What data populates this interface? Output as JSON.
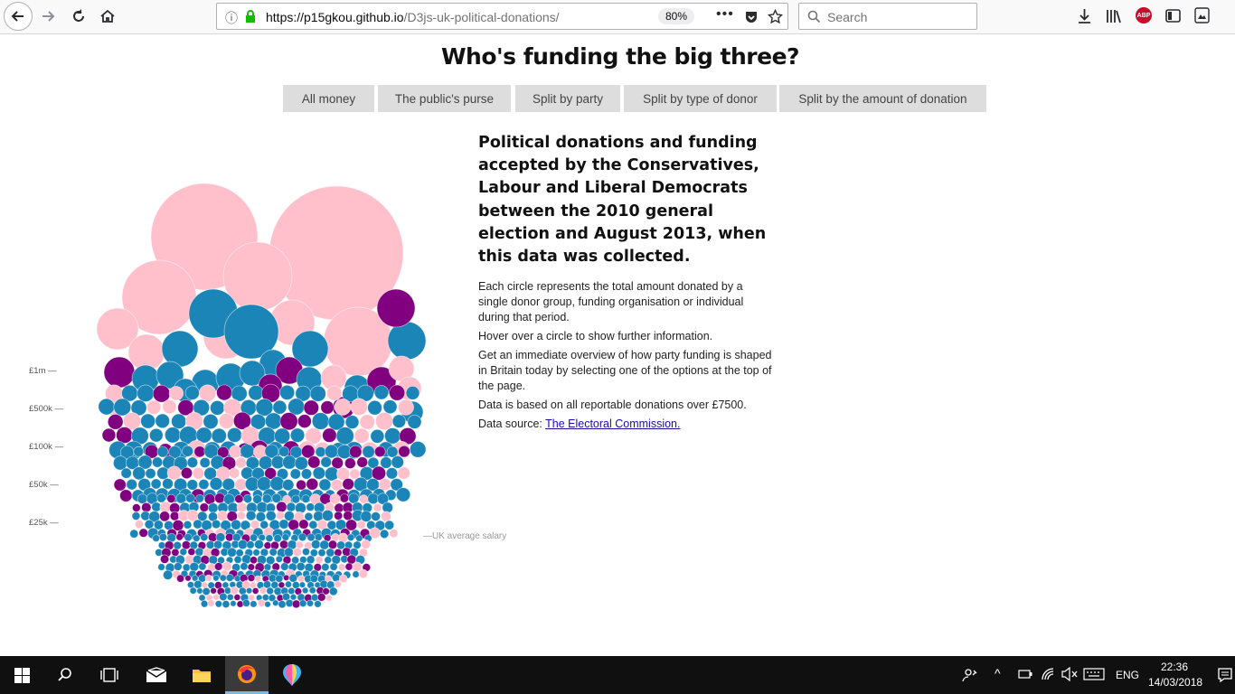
{
  "browser": {
    "url_host": "https://p15gkou.github.io",
    "url_path": "/D3js-uk-political-donations/",
    "zoom": "80%",
    "search_placeholder": "Search"
  },
  "page": {
    "title": "Who's funding the big three?",
    "nav": [
      {
        "label": "All money"
      },
      {
        "label": "The public's purse"
      },
      {
        "label": "Split by party"
      },
      {
        "label": "Split by type of donor"
      },
      {
        "label": "Split by the amount of donation"
      }
    ],
    "headline": "Political donations and funding accepted by the Conservatives, Labour and Liberal Democrats between the 2010 general election and August 2013, when this data was collected.",
    "paragraphs": [
      "Each circle represents the total amount donated by a single donor group, funding organisation or individual during that period.",
      "Hover over a circle to show further information.",
      "Get an immediate overview of how party funding is shaped in Britain today by selecting one of the options at the top of the page.",
      "Data is based on all reportable donations over £7500."
    ],
    "source_prefix": "Data source: ",
    "source_link": "The Electoral Commission."
  },
  "chart_data": {
    "type": "scatter",
    "description_scale": [
      "£1m —",
      "£500k —",
      "£100k —",
      "£50k —",
      "£25k —"
    ],
    "salary_label": "—UK average salary",
    "colors": {
      "conservatives": "#1b85b8",
      "labour": "#ffc0cb",
      "libdems": "#800080"
    }
  },
  "taskbar": {
    "language": "ENG",
    "time": "22:36",
    "date": "14/03/2018"
  }
}
